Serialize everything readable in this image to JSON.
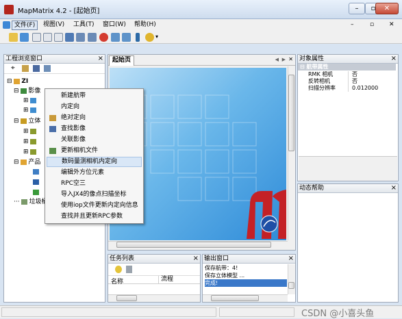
{
  "window": {
    "title": "MapMatrix 4.2 - [起始页]"
  },
  "menu": [
    "文件(F)",
    "视图(V)",
    "工具(T)",
    "窗口(W)",
    "帮助(H)"
  ],
  "project_panel": {
    "title": "工程浏览窗口",
    "root": "ZI",
    "item_image": "影像",
    "item_stereo": "立体",
    "item_product": "产品",
    "item_trash": "垃圾桶"
  },
  "context_menu": [
    "新建航带",
    "内定向",
    "绝对定向",
    "查找影像",
    "关联影像",
    "更新相机文件",
    "数码量测相机内定向",
    "编辑外方位元素",
    "RPC空三",
    "导入JX4的像点扫描坐标",
    "使用iop文件更新内定向信息",
    "查找并且更新RPC参数"
  ],
  "context_menu_selected": 6,
  "document": {
    "tab": "起始页",
    "nav_left": "◀",
    "nav_right": "▶",
    "close": "✕"
  },
  "properties": {
    "title": "对象属性",
    "group": "航带属性",
    "rows": [
      {
        "name": "RMK 相机",
        "value": "否"
      },
      {
        "name": "反转相机",
        "value": "否"
      },
      {
        "name": "扫描分辨率",
        "value": "0.012000"
      }
    ]
  },
  "help_panel": {
    "title": "动态帮助"
  },
  "task_panel": {
    "title": "任务列表",
    "col_name": "名称",
    "col_flow": "流程"
  },
  "output_panel": {
    "title": "输出窗口",
    "lines": [
      "保存航带：4!",
      "保存立体模型 ...",
      "完成!"
    ]
  },
  "watermark": "CSDN @小喜头鱼",
  "colors": {
    "accent": "#3e88d6",
    "logo_red": "#c42126",
    "selection": "#d9e7f7"
  }
}
